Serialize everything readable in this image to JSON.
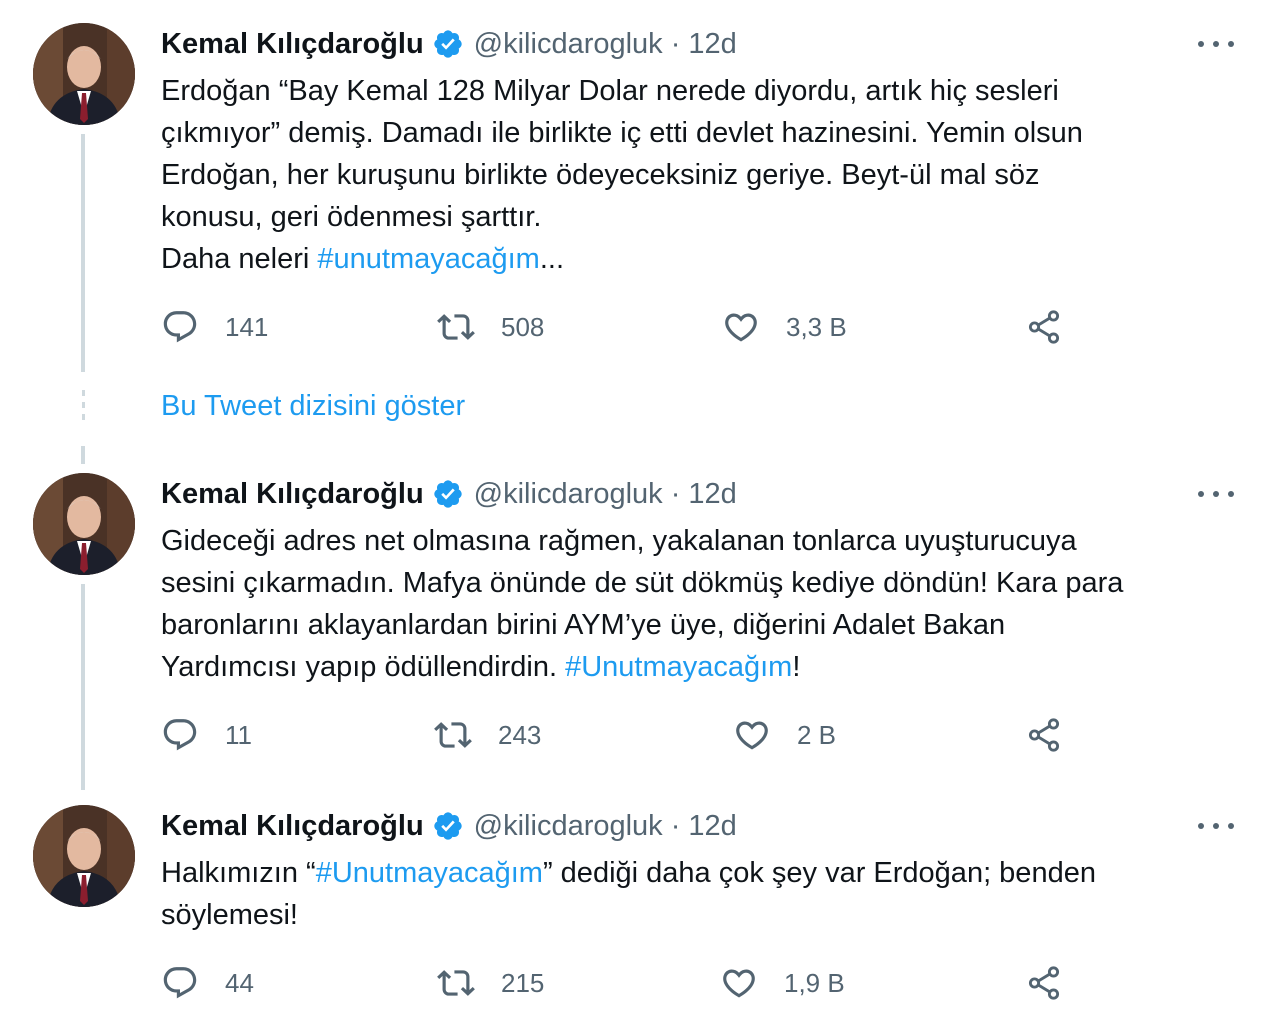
{
  "theme": {
    "accent": "#1d9bf0",
    "text": "#0f1419",
    "muted": "#536471",
    "line": "#cfd9de"
  },
  "tweets": [
    {
      "name": "Kemal Kılıçdaroğlu",
      "handle": "@kilicdarogluk",
      "separator": "·",
      "time": "12d",
      "text_before": "Erdoğan “Bay Kemal 128 Milyar Dolar nerede diyordu, artık hiç sesleri\nçıkmıyor” demiş. Damadı ile birlikte iç etti devlet hazinesini. Yemin olsun\nErdoğan, her kuruşunu birlikte ödeyeceksiniz geriye. Beyt-ül mal söz\nkonusu, geri ödenmesi şarttır.\nDaha neleri ",
      "hashtag": "#unutmayacağım",
      "text_after": "...",
      "replies": "141",
      "retweets": "508",
      "likes": "3,3 B"
    },
    {
      "name": "Kemal Kılıçdaroğlu",
      "handle": "@kilicdarogluk",
      "separator": "·",
      "time": "12d",
      "text_before": "Gideceği adres net olmasına rağmen, yakalanan tonlarca uyuşturucuya\nsesini çıkarmadın. Mafya önünde de süt dökmüş kediye döndün! Kara para\nbaronlarını aklayanlardan birini AYM’ye üye, diğerini Adalet Bakan\nYardımcısı yapıp ödüllendirdin. ",
      "hashtag": "#Unutmayacağım",
      "text_after": "!",
      "replies": "11",
      "retweets": "243",
      "likes": "2 B"
    },
    {
      "name": "Kemal Kılıçdaroğlu",
      "handle": "@kilicdarogluk",
      "separator": "·",
      "time": "12d",
      "text_before": "Halkımızın “",
      "hashtag": "#Unutmayacağım",
      "text_after": "” dediği daha çok şey var Erdoğan; benden\nsöylemesi!",
      "replies": "44",
      "retweets": "215",
      "likes": "1,9 B"
    }
  ],
  "show_thread_label": "Bu Tweet dizisini göster",
  "icons": [
    "verified-badge-icon",
    "more-icon",
    "reply-icon",
    "retweet-icon",
    "like-icon",
    "share-icon"
  ]
}
